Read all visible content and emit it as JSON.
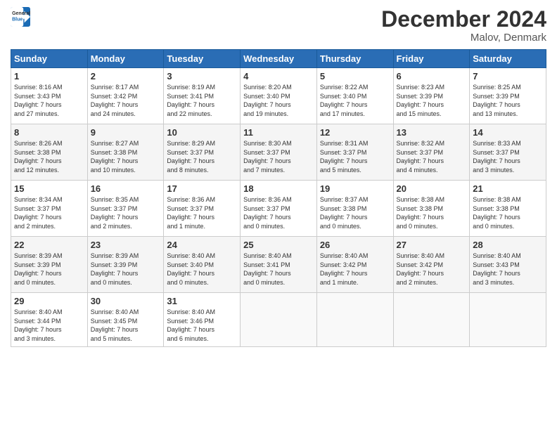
{
  "header": {
    "logo_line1": "General",
    "logo_line2": "Blue",
    "month": "December 2024",
    "location": "Malov, Denmark"
  },
  "days_of_week": [
    "Sunday",
    "Monday",
    "Tuesday",
    "Wednesday",
    "Thursday",
    "Friday",
    "Saturday"
  ],
  "weeks": [
    [
      {
        "day": "1",
        "info": "Sunrise: 8:16 AM\nSunset: 3:43 PM\nDaylight: 7 hours\nand 27 minutes."
      },
      {
        "day": "2",
        "info": "Sunrise: 8:17 AM\nSunset: 3:42 PM\nDaylight: 7 hours\nand 24 minutes."
      },
      {
        "day": "3",
        "info": "Sunrise: 8:19 AM\nSunset: 3:41 PM\nDaylight: 7 hours\nand 22 minutes."
      },
      {
        "day": "4",
        "info": "Sunrise: 8:20 AM\nSunset: 3:40 PM\nDaylight: 7 hours\nand 19 minutes."
      },
      {
        "day": "5",
        "info": "Sunrise: 8:22 AM\nSunset: 3:40 PM\nDaylight: 7 hours\nand 17 minutes."
      },
      {
        "day": "6",
        "info": "Sunrise: 8:23 AM\nSunset: 3:39 PM\nDaylight: 7 hours\nand 15 minutes."
      },
      {
        "day": "7",
        "info": "Sunrise: 8:25 AM\nSunset: 3:39 PM\nDaylight: 7 hours\nand 13 minutes."
      }
    ],
    [
      {
        "day": "8",
        "info": "Sunrise: 8:26 AM\nSunset: 3:38 PM\nDaylight: 7 hours\nand 12 minutes."
      },
      {
        "day": "9",
        "info": "Sunrise: 8:27 AM\nSunset: 3:38 PM\nDaylight: 7 hours\nand 10 minutes."
      },
      {
        "day": "10",
        "info": "Sunrise: 8:29 AM\nSunset: 3:37 PM\nDaylight: 7 hours\nand 8 minutes."
      },
      {
        "day": "11",
        "info": "Sunrise: 8:30 AM\nSunset: 3:37 PM\nDaylight: 7 hours\nand 7 minutes."
      },
      {
        "day": "12",
        "info": "Sunrise: 8:31 AM\nSunset: 3:37 PM\nDaylight: 7 hours\nand 5 minutes."
      },
      {
        "day": "13",
        "info": "Sunrise: 8:32 AM\nSunset: 3:37 PM\nDaylight: 7 hours\nand 4 minutes."
      },
      {
        "day": "14",
        "info": "Sunrise: 8:33 AM\nSunset: 3:37 PM\nDaylight: 7 hours\nand 3 minutes."
      }
    ],
    [
      {
        "day": "15",
        "info": "Sunrise: 8:34 AM\nSunset: 3:37 PM\nDaylight: 7 hours\nand 2 minutes."
      },
      {
        "day": "16",
        "info": "Sunrise: 8:35 AM\nSunset: 3:37 PM\nDaylight: 7 hours\nand 2 minutes."
      },
      {
        "day": "17",
        "info": "Sunrise: 8:36 AM\nSunset: 3:37 PM\nDaylight: 7 hours\nand 1 minute."
      },
      {
        "day": "18",
        "info": "Sunrise: 8:36 AM\nSunset: 3:37 PM\nDaylight: 7 hours\nand 0 minutes."
      },
      {
        "day": "19",
        "info": "Sunrise: 8:37 AM\nSunset: 3:38 PM\nDaylight: 7 hours\nand 0 minutes."
      },
      {
        "day": "20",
        "info": "Sunrise: 8:38 AM\nSunset: 3:38 PM\nDaylight: 7 hours\nand 0 minutes."
      },
      {
        "day": "21",
        "info": "Sunrise: 8:38 AM\nSunset: 3:38 PM\nDaylight: 7 hours\nand 0 minutes."
      }
    ],
    [
      {
        "day": "22",
        "info": "Sunrise: 8:39 AM\nSunset: 3:39 PM\nDaylight: 7 hours\nand 0 minutes."
      },
      {
        "day": "23",
        "info": "Sunrise: 8:39 AM\nSunset: 3:39 PM\nDaylight: 7 hours\nand 0 minutes."
      },
      {
        "day": "24",
        "info": "Sunrise: 8:40 AM\nSunset: 3:40 PM\nDaylight: 7 hours\nand 0 minutes."
      },
      {
        "day": "25",
        "info": "Sunrise: 8:40 AM\nSunset: 3:41 PM\nDaylight: 7 hours\nand 0 minutes."
      },
      {
        "day": "26",
        "info": "Sunrise: 8:40 AM\nSunset: 3:42 PM\nDaylight: 7 hours\nand 1 minute."
      },
      {
        "day": "27",
        "info": "Sunrise: 8:40 AM\nSunset: 3:42 PM\nDaylight: 7 hours\nand 2 minutes."
      },
      {
        "day": "28",
        "info": "Sunrise: 8:40 AM\nSunset: 3:43 PM\nDaylight: 7 hours\nand 3 minutes."
      }
    ],
    [
      {
        "day": "29",
        "info": "Sunrise: 8:40 AM\nSunset: 3:44 PM\nDaylight: 7 hours\nand 3 minutes."
      },
      {
        "day": "30",
        "info": "Sunrise: 8:40 AM\nSunset: 3:45 PM\nDaylight: 7 hours\nand 5 minutes."
      },
      {
        "day": "31",
        "info": "Sunrise: 8:40 AM\nSunset: 3:46 PM\nDaylight: 7 hours\nand 6 minutes."
      },
      null,
      null,
      null,
      null
    ]
  ]
}
